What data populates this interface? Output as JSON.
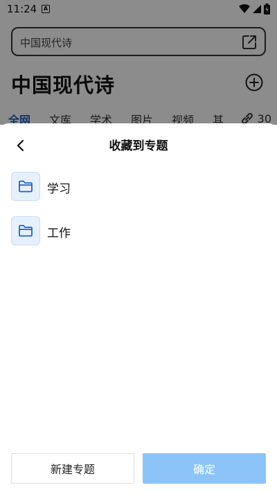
{
  "status_bar": {
    "time": "11:24",
    "notification_letter": "A"
  },
  "search": {
    "value": "中国现代诗"
  },
  "header": {
    "title": "中国现代诗"
  },
  "tabs": [
    {
      "label": "全网",
      "active": true
    },
    {
      "label": "文库",
      "active": false
    },
    {
      "label": "学术",
      "active": false
    },
    {
      "label": "图片",
      "active": false
    },
    {
      "label": "视频",
      "active": false
    },
    {
      "label": "其",
      "active": false
    }
  ],
  "tab_count": "30",
  "sheet": {
    "title": "收藏到专题",
    "folders": [
      {
        "label": "学习"
      },
      {
        "label": "工作"
      }
    ],
    "new_button_label": "新建专题",
    "confirm_button_label": "确定"
  },
  "colors": {
    "accent": "#1f5fc6",
    "confirm_disabled": "#8cc4fa",
    "folder_bg": "#e6f0fd"
  }
}
